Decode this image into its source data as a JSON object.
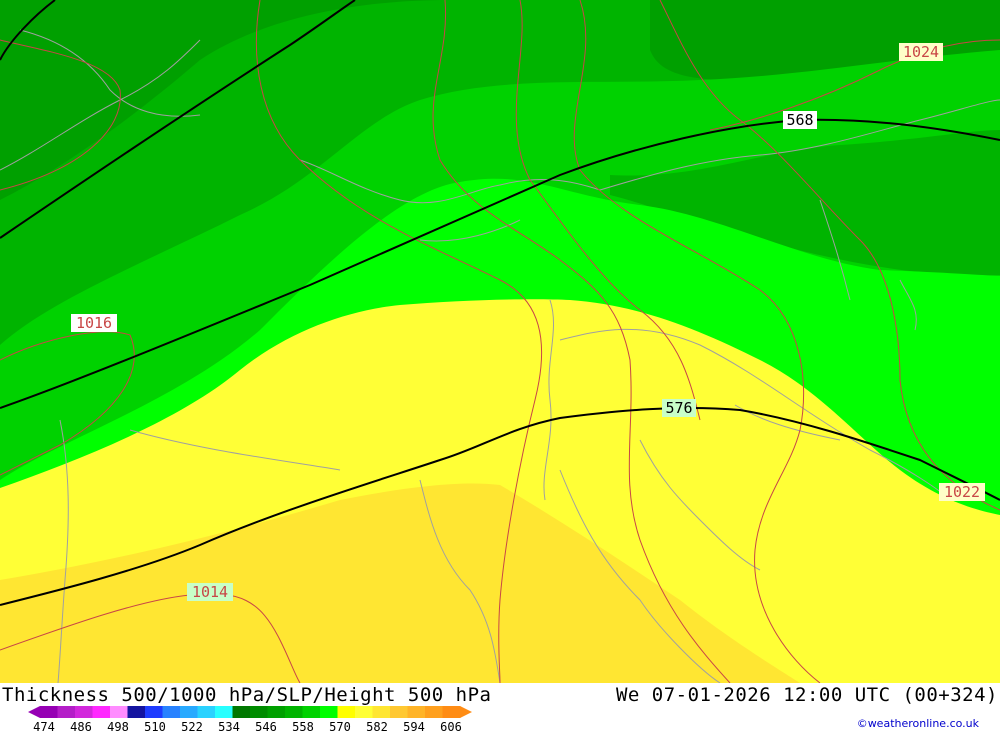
{
  "map": {
    "isobar_labels": [
      "1024",
      "1016",
      "1022",
      "1014"
    ],
    "height_labels": [
      "568",
      "576"
    ],
    "colors": {
      "dark_green": "#00a000",
      "mid_green": "#00b400",
      "green": "#00d200",
      "bright_green": "#00ff00",
      "yellow": "#ffff36",
      "dark_yellow": "#ffe632",
      "isobar": "#c84646",
      "height": "#000000",
      "border": "#a0a0a0"
    }
  },
  "footer": {
    "title_left": "Thickness 500/1000 hPa/SLP/Height 500 hPa",
    "title_right": "We 07-01-2026 12:00 UTC (00+324)",
    "credit": "©weatheronline.co.uk",
    "legend": {
      "ticks": [
        "474",
        "486",
        "498",
        "510",
        "522",
        "534",
        "546",
        "558",
        "570",
        "582",
        "594",
        "606"
      ],
      "colors": [
        "#9600b4",
        "#b41ec8",
        "#d228dc",
        "#ff28ff",
        "#ff8cff",
        "#1414a0",
        "#1e3cff",
        "#2882ff",
        "#28aaff",
        "#2ad2ff",
        "#28ffff",
        "#007800",
        "#008c00",
        "#00a000",
        "#00b400",
        "#00d200",
        "#00ff00",
        "#ffff00",
        "#ffff36",
        "#ffe632",
        "#ffc832",
        "#ffb428",
        "#ffa01e",
        "#ff8c14"
      ]
    }
  }
}
